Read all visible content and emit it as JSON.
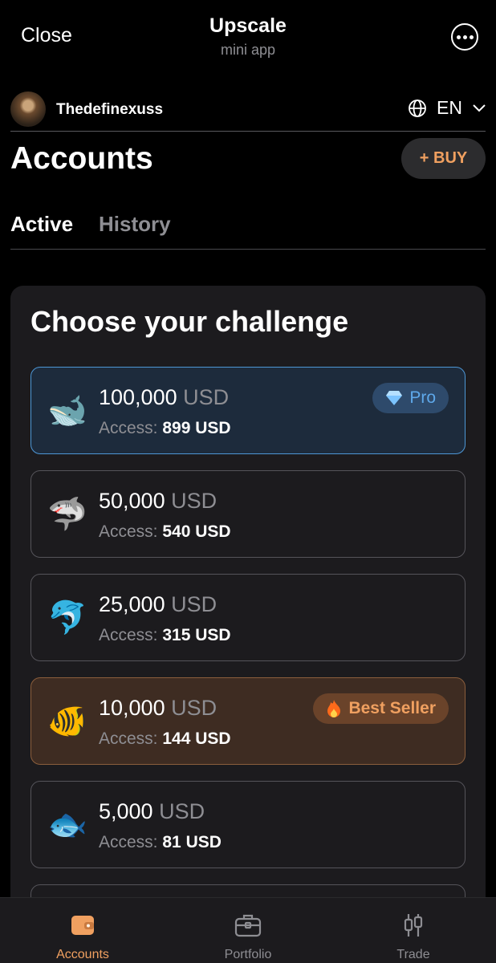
{
  "topbar": {
    "close_label": "Close",
    "title": "Upscale",
    "subtitle": "mini app",
    "more_icon": "more-horizontal-icon"
  },
  "user": {
    "name": "Thedefinexuss",
    "language": "EN"
  },
  "header": {
    "title": "Accounts",
    "buy_label": "+ BUY"
  },
  "tabs": [
    {
      "label": "Active",
      "active": true
    },
    {
      "label": "History",
      "active": false
    }
  ],
  "challenge": {
    "title": "Choose your challenge",
    "access_label": "Access:",
    "plans": [
      {
        "icon": "whale-icon",
        "emoji": "🐋",
        "amount": "100,000",
        "currency": "USD",
        "access": "899 USD",
        "badge": "Pro",
        "badge_icon": "diamond-icon"
      },
      {
        "icon": "shark-icon",
        "emoji": "🦈",
        "amount": "50,000",
        "currency": "USD",
        "access": "540 USD"
      },
      {
        "icon": "dolphin-icon",
        "emoji": "🐬",
        "amount": "25,000",
        "currency": "USD",
        "access": "315 USD"
      },
      {
        "icon": "tropical-fish-icon",
        "emoji": "🐠",
        "amount": "10,000",
        "currency": "USD",
        "access": "144 USD",
        "badge": "Best Seller",
        "badge_icon": "fire-icon"
      },
      {
        "icon": "fish-icon",
        "emoji": "🐟",
        "amount": "5,000",
        "currency": "USD",
        "access": "81 USD"
      }
    ]
  },
  "nav": [
    {
      "label": "Accounts",
      "icon": "wallet-icon",
      "active": true
    },
    {
      "label": "Portfolio",
      "icon": "briefcase-icon",
      "active": false
    },
    {
      "label": "Trade",
      "icon": "candlestick-icon",
      "active": false
    }
  ],
  "colors": {
    "accent": "#f0a060",
    "pro": "#5ea8ea",
    "background": "#000000",
    "card": "#1c1b1e"
  }
}
